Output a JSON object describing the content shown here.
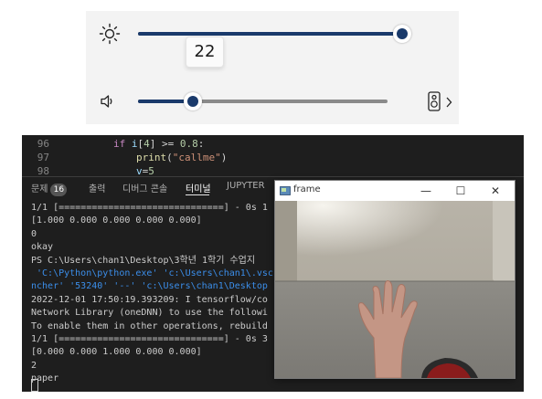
{
  "quick_settings": {
    "brightness": {
      "value": 100,
      "icon": "sun-icon"
    },
    "brightness_tooltip": "22",
    "volume": {
      "value": 22,
      "icon": "speaker-icon",
      "output_icon": "audio-device-icon"
    },
    "accent_color": "#1a3a6b"
  },
  "editor": {
    "lines": [
      {
        "number": "96",
        "tokens": [
          [
            "kw",
            "if "
          ],
          [
            "var",
            "i"
          ],
          [
            "op",
            "["
          ],
          [
            "num",
            "4"
          ],
          [
            "op",
            "] >= "
          ],
          [
            "num",
            "0.8"
          ],
          [
            "op",
            ":"
          ]
        ],
        "indent": 2
      },
      {
        "number": "97",
        "tokens": [
          [
            "fn",
            "print"
          ],
          [
            "op",
            "("
          ],
          [
            "str",
            "\"callme\""
          ],
          [
            "op",
            ")"
          ]
        ],
        "indent": 3
      },
      {
        "number": "98",
        "tokens": [
          [
            "var",
            "v"
          ],
          [
            "op",
            "="
          ],
          [
            "num",
            "5"
          ]
        ],
        "indent": 3
      }
    ]
  },
  "panel": {
    "tabs": [
      {
        "label": "문제",
        "badge": "16"
      },
      {
        "label": "출력"
      },
      {
        "label": "디버그 콘솔"
      },
      {
        "label": "터미널",
        "active": true
      },
      {
        "label": "JUPYTER"
      }
    ]
  },
  "terminal": {
    "lines": [
      {
        "text": "1/1 [==============================] - 0s 1",
        "color": "default"
      },
      {
        "text": "[1.000 0.000 0.000 0.000 0.000]",
        "color": "default"
      },
      {
        "text": "0",
        "color": "default"
      },
      {
        "text": "okay",
        "color": "default"
      },
      {
        "text": "PS C:\\Users\\chan1\\Desktop\\3학년 1학기 수업지",
        "color": "default"
      },
      {
        "text": " 'C:\\Python\\python.exe' 'c:\\Users\\chan1\\.vsc",
        "color": "blue"
      },
      {
        "text": "ncher' '53240' '--' 'c:\\Users\\chan1\\Desktop",
        "color": "blue"
      },
      {
        "text": "2022-12-01 17:50:19.393209: I tensorflow/co",
        "color": "default"
      },
      {
        "text": "Network Library (oneDNN) to use the followi",
        "color": "default"
      },
      {
        "text": "To enable them in other operations, rebuild",
        "color": "default"
      },
      {
        "text": "1/1 [==============================] - 0s 3",
        "color": "default"
      },
      {
        "text": "[0.000 0.000 1.000 0.000 0.000]",
        "color": "default"
      },
      {
        "text": "2",
        "color": "default"
      },
      {
        "text": "paper",
        "color": "default"
      }
    ]
  },
  "frame_window": {
    "title": "frame",
    "minimize": "—",
    "maximize": "☐",
    "close": "✕"
  }
}
